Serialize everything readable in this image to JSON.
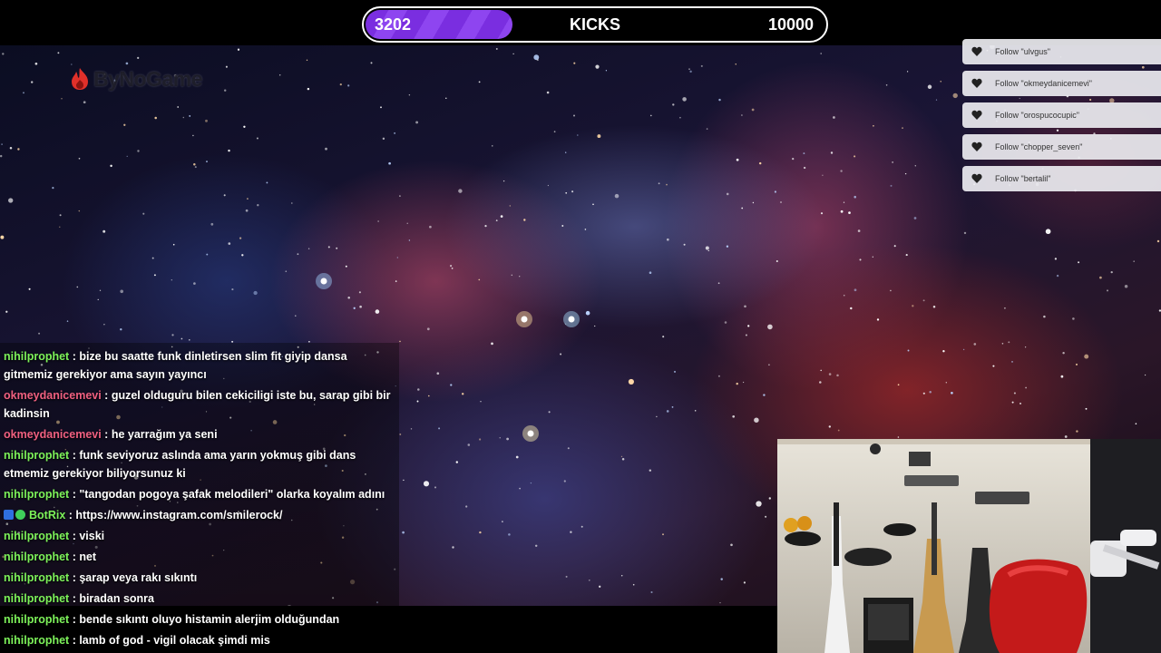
{
  "goal": {
    "current": "3202",
    "label": "KICKS",
    "target": "10000",
    "progress_fraction": 0.32,
    "fill_color": "#7a2ee0"
  },
  "logo": {
    "text": "ByNoGame",
    "icon": "flame-logo-icon",
    "color": "#e0302a"
  },
  "follows": [
    {
      "text": "Follow \"ulvgus\""
    },
    {
      "text": "Follow \"okmeydanicemevi\""
    },
    {
      "text": "Follow \"orospucocupic\""
    },
    {
      "text": "Follow \"chopper_seven\""
    },
    {
      "text": "Follow \"bertalil\""
    }
  ],
  "chat": [
    {
      "user": "nihilprophet",
      "color": "#7df25a",
      "message": "bize bu saatte funk dinletirsen slim fit giyip dansa gitmemiz gerekiyor ama sayın yayıncı"
    },
    {
      "user": "okmeydanicemevi",
      "color": "#f06080",
      "message": "guzel olduguru bilen cekiciligi iste bu, sarap gibi bir kadinsin"
    },
    {
      "user": "okmeydanicemevi",
      "color": "#f06080",
      "message": "he yarrağım ya seni"
    },
    {
      "user": "nihilprophet",
      "color": "#7df25a",
      "message": "funk seviyoruz aslında ama yarın yokmuş gibi dans etmemiz gerekiyor biliyorsunuz ki"
    },
    {
      "user": "nihilprophet",
      "color": "#7df25a",
      "message": "\"tangodan pogoya şafak melodileri\" olarka koyalım adını"
    },
    {
      "user": "BotRix",
      "color": "#7df25a",
      "message": "https://www.instagram.com/smilerock/",
      "bot": true
    },
    {
      "user": "nihilprophet",
      "color": "#7df25a",
      "message": "viski"
    },
    {
      "user": "nihilprophet",
      "color": "#7df25a",
      "message": "net"
    },
    {
      "user": "nihilprophet",
      "color": "#7df25a",
      "message": "şarap veya rakı sıkıntı"
    },
    {
      "user": "nihilprophet",
      "color": "#7df25a",
      "message": "biradan sonra"
    },
    {
      "user": "nihilprophet",
      "color": "#7df25a",
      "message": "bende sıkıntı oluyo histamin alerjim olduğundan"
    },
    {
      "user": "nihilprophet",
      "color": "#7df25a",
      "message": "lamb of god - vigil olacak şimdi mis"
    }
  ],
  "chat_separator": " : ",
  "colors": {
    "background": "#000000",
    "follow_bg": "#ebebf0"
  }
}
